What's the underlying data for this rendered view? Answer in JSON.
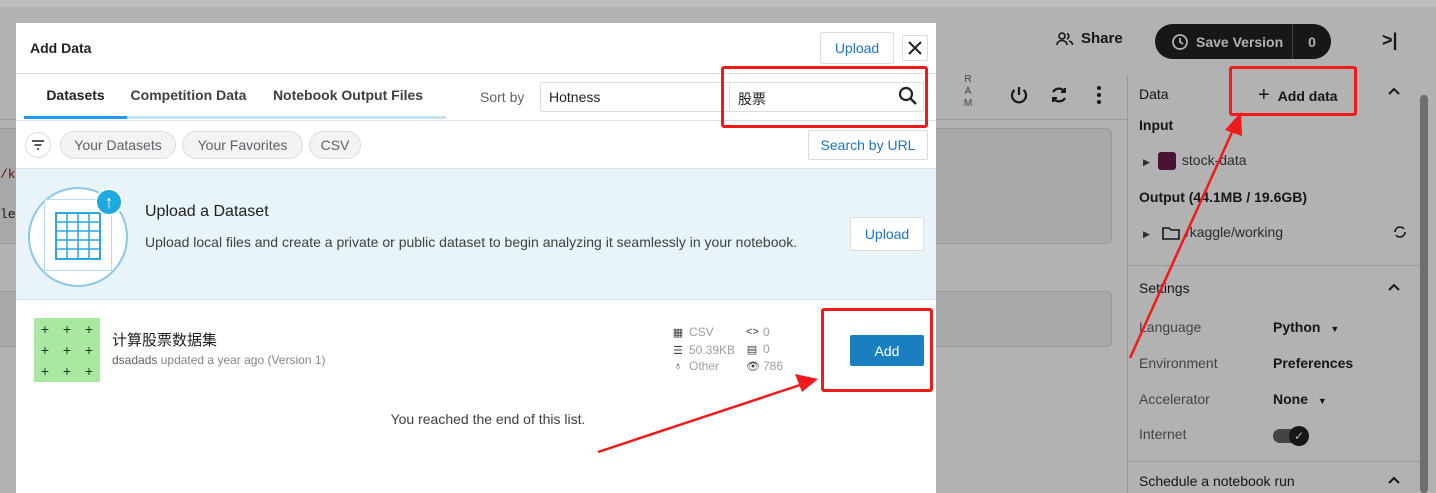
{
  "header": {
    "share_label": "Share",
    "save_version_label": "Save Version",
    "save_version_count": "0",
    "collapse_glyph": ">|"
  },
  "toolbar": {
    "ram_label": "R A M"
  },
  "code_fragments": [
    "/k",
    "le"
  ],
  "right_panel": {
    "data_label": "Data",
    "add_data_label": "Add data",
    "input_label": "Input",
    "input_dataset": "stock-data",
    "output_label": "Output (44.1MB / 19.6GB)",
    "output_dir": "/kaggle/working",
    "settings_label": "Settings",
    "settings": [
      {
        "key": "Language",
        "value": "Python",
        "has_dropdown": true
      },
      {
        "key": "Environment",
        "value": "Preferences",
        "has_dropdown": false
      },
      {
        "key": "Accelerator",
        "value": "None",
        "has_dropdown": true
      },
      {
        "key": "Internet",
        "value": "",
        "has_dropdown": false
      }
    ],
    "schedule_label": "Schedule a notebook run"
  },
  "modal": {
    "title": "Add Data",
    "upload_label": "Upload",
    "tabs": [
      "Datasets",
      "Competition Data",
      "Notebook Output Files"
    ],
    "sort_label": "Sort by",
    "sort_value": "Hotness",
    "search_value": "股票",
    "chips": [
      "Your Datasets",
      "Your Favorites",
      "CSV"
    ],
    "search_by_url_label": "Search by URL",
    "upload_banner": {
      "title": "Upload a Dataset",
      "description": "Upload local files and create a private or public dataset to begin analyzing it seamlessly in your notebook.",
      "button": "Upload"
    },
    "dataset": {
      "name": "计算股票数据集",
      "owner": "dsadads",
      "updated": "updated a year ago (Version 1)",
      "stats": {
        "format": "CSV",
        "size": "50.39KB",
        "license": "Other",
        "code_count": "0",
        "discussion_count": "0",
        "views": "786"
      },
      "add_label": "Add"
    },
    "end_text": "You reached the end of this list."
  }
}
